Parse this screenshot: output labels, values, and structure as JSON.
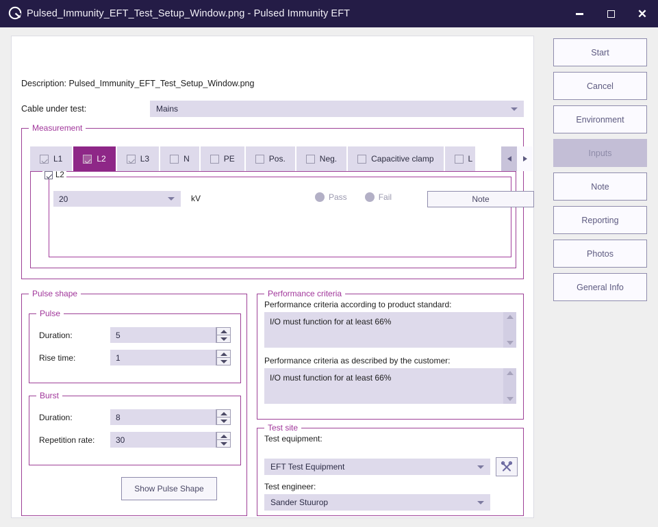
{
  "window": {
    "logo_icon": "app-logo-icon",
    "title": "Pulsed_Immunity_EFT_Test_Setup_Window.png - Pulsed Immunity EFT",
    "minimize_icon": "minimize-icon",
    "maximize_icon": "maximize-icon",
    "close_icon": "close-icon",
    "close_glyph": "✕"
  },
  "colors": {
    "titlebar_bg": "#241c46",
    "accent_purple": "#8e2787",
    "group_border": "#9d3f96",
    "field_bg": "#dedaeb",
    "button_bg": "#fbfaff",
    "active_button_bg": "#c3bed6"
  },
  "form": {
    "description": "Description: Pulsed_Immunity_EFT_Test_Setup_Window.png",
    "cable_label": "Cable under test:",
    "cable_value": "Mains"
  },
  "measurement": {
    "legend": "Measurement",
    "tabs": [
      {
        "label": "L1",
        "checked": true,
        "active": false
      },
      {
        "label": "L2",
        "checked": true,
        "active": true
      },
      {
        "label": "L3",
        "checked": true,
        "active": false
      },
      {
        "label": "N",
        "checked": false,
        "active": false
      },
      {
        "label": "PE",
        "checked": false,
        "active": false
      },
      {
        "label": "Pos.",
        "checked": false,
        "active": false
      },
      {
        "label": "Neg.",
        "checked": false,
        "active": false
      },
      {
        "label": "Capacitive clamp",
        "checked": false,
        "active": false
      },
      {
        "label": "L",
        "checked": false,
        "active": false,
        "clipped": true
      }
    ],
    "scroll_left_icon": "scroll-left-icon",
    "scroll_right_icon": "scroll-right-icon",
    "page": {
      "legend": "L2",
      "level_value": "20",
      "unit": "kV",
      "pass_label": "Pass",
      "fail_label": "Fail",
      "note_label": "Note"
    }
  },
  "pulse_shape": {
    "legend": "Pulse shape",
    "pulse": {
      "legend": "Pulse",
      "duration_label": "Duration:",
      "duration_value": "5",
      "rise_time_label": "Rise time:",
      "rise_time_value": "1"
    },
    "burst": {
      "legend": "Burst",
      "duration_label": "Duration:",
      "duration_value": "8",
      "repetition_label": "Repetition rate:",
      "repetition_value": "30"
    },
    "show_pulse_button": "Show Pulse Shape"
  },
  "performance": {
    "legend": "Performance criteria",
    "standard_label": "Performance criteria according to product standard:",
    "standard_value": "I/O must function for at least 66%",
    "customer_label": "Performance criteria as described by the customer:",
    "customer_value": "I/O must function for at least 66%"
  },
  "test_site": {
    "legend": "Test site",
    "equipment_label": "Test equipment:",
    "equipment_value": "EFT Test Equipment",
    "tools_icon": "tools-icon",
    "engineer_label": "Test engineer:",
    "engineer_value": "Sander Stuurop"
  },
  "sidebar": {
    "buttons": [
      {
        "label": "Start",
        "active": false
      },
      {
        "label": "Cancel",
        "active": false
      },
      {
        "label": "Environment",
        "active": false
      },
      {
        "label": "Inputs",
        "active": true
      },
      {
        "label": "Note",
        "active": false
      },
      {
        "label": "Reporting",
        "active": false
      },
      {
        "label": "Photos",
        "active": false
      },
      {
        "label": "General Info",
        "active": false
      }
    ]
  }
}
